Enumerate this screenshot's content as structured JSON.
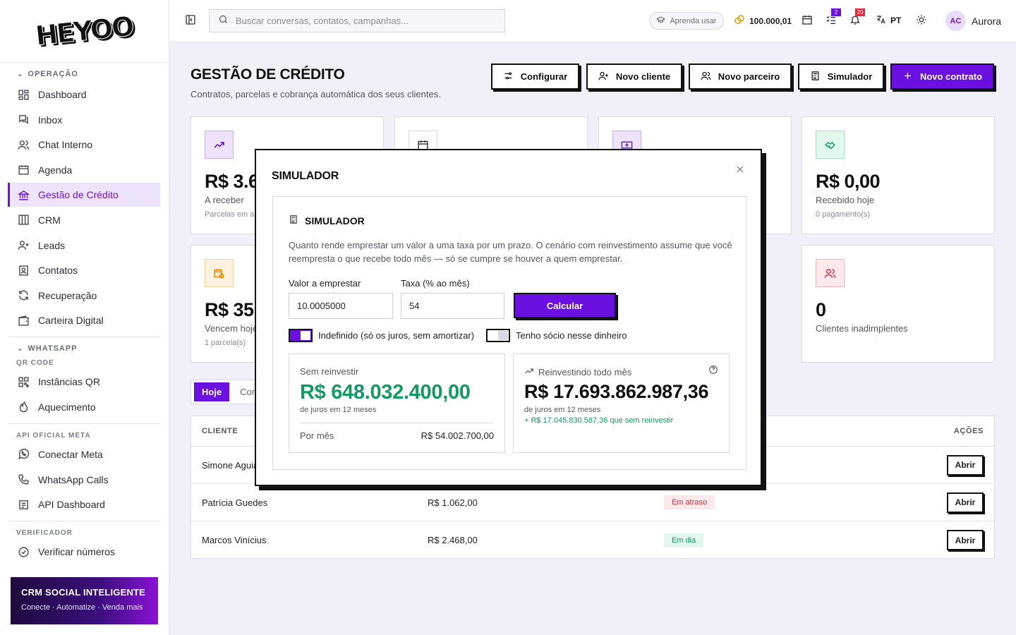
{
  "sidebar": {
    "logo": "HEYOO",
    "sections": [
      {
        "title": "OPERAÇÃO"
      },
      {
        "title": "WHATSAPP"
      }
    ],
    "items": [
      {
        "label": "Dashboard",
        "icon": "dashboard-icon"
      },
      {
        "label": "Inbox",
        "icon": "inbox-icon"
      },
      {
        "label": "Chat Interno",
        "icon": "users-icon"
      },
      {
        "label": "Agenda",
        "icon": "calendar-icon"
      },
      {
        "label": "Gestão de Crédito",
        "icon": "bank-icon"
      },
      {
        "label": "CRM",
        "icon": "columns-icon"
      },
      {
        "label": "Leads",
        "icon": "user-plus-icon"
      },
      {
        "label": "Contatos",
        "icon": "contact-icon"
      },
      {
        "label": "Recuperação",
        "icon": "refresh-icon"
      },
      {
        "label": "Carteira Digital",
        "icon": "wallet-icon"
      },
      {
        "label": "Instâncias QR",
        "icon": "qr-icon"
      },
      {
        "label": "Aquecimento",
        "icon": "flame-icon"
      },
      {
        "label": "Conectar Meta",
        "icon": "whatsapp-icon"
      },
      {
        "label": "WhatsApp Calls",
        "icon": "phone-icon"
      },
      {
        "label": "API Dashboard",
        "icon": "api-icon"
      },
      {
        "label": "Verificar números",
        "icon": "check-circle-icon"
      }
    ],
    "subheads": {
      "qr": "QR CODE",
      "meta": "API OFICIAL META",
      "verif": "VERIFICADOR"
    },
    "promo": {
      "title": "CRM SOCIAL INTELIGENTE",
      "subtitle": "Conecte · Automatize · Venda mais"
    }
  },
  "topbar": {
    "search_placeholder": "Buscar conversas, contatos, campanhas...",
    "learn_label": "Aprenda usar",
    "credits": "100.000,01",
    "tasks_badge": "2",
    "notif_badge": "20",
    "lang": "PT",
    "user_initials": "AC",
    "user_name": "Aurora"
  },
  "page": {
    "title": "GESTÃO DE CRÉDITO",
    "subtitle": "Contratos, parcelas e cobrança automática dos seus clientes.",
    "buttons": {
      "configure": "Configurar",
      "new_client": "Novo cliente",
      "new_partner": "Novo parceiro",
      "simulator": "Simulador",
      "new_contract": "Novo contrato"
    }
  },
  "cards": {
    "receivable": {
      "value": "R$ 3.6",
      "label": "A receber",
      "sub": "Parcelas em ab"
    },
    "received_today": {
      "value": "R$ 0,00",
      "label": "Recebido hoje",
      "sub": "0 pagamento(s)"
    },
    "due_today": {
      "value": "R$ 35",
      "label": "Vencem hoje",
      "sub": "1 parcela(s)"
    },
    "defaulters": {
      "value": "0",
      "label": "Clientes inadimplentes"
    }
  },
  "tabs": {
    "today": "Hoje",
    "other": "Con"
  },
  "table": {
    "headers": {
      "client": "CLIENTE",
      "actions": "AÇÕES"
    },
    "rows": [
      {
        "name": "Simone Aguia",
        "value": "",
        "status": "",
        "action": "Abrir"
      },
      {
        "name": "Patrícia Guedes",
        "value": "R$ 1.062,00",
        "status": "Em atraso",
        "action": "Abrir"
      },
      {
        "name": "Marcos Vinícius",
        "value": "R$ 2.468,00",
        "status": "Em dia",
        "action": "Abrir"
      }
    ]
  },
  "modal": {
    "title": "SIMULADOR",
    "inner_title": "SIMULADOR",
    "description": "Quanto rende emprestar um valor a uma taxa por um prazo. O cenário com reinvestimento assume que você reempresta o que recebe todo mês — só se cumpre se houver a quem emprestar.",
    "amount_label": "Valor a emprestar",
    "amount_value": "10.0005000",
    "rate_label": "Taxa (% ao mês)",
    "rate_value": "54",
    "calc_label": "Calcular",
    "toggle_undefined": {
      "label": "Indefinido (só os juros, sem amortizar)",
      "on": true
    },
    "toggle_partner": {
      "label": "Tenho sócio nesse dinheiro",
      "on": false
    },
    "no_reinvest": {
      "title": "Sem reinvestir",
      "value": "R$ 648.032.400,00",
      "caption": "de juros em 12 meses",
      "monthly_label": "Por mês",
      "monthly_value": "R$ 54.002.700,00"
    },
    "reinvest": {
      "title": "Reinvestindo todo mês",
      "value": "R$ 17.693.862.987,36",
      "caption": "de juros em 12 meses",
      "extra": "+ R$ 17.045.830.587,36 que sem reinvestir"
    }
  },
  "colors": {
    "accent": "#6a10e0",
    "green": "#129a63",
    "red": "#d92d3e"
  }
}
